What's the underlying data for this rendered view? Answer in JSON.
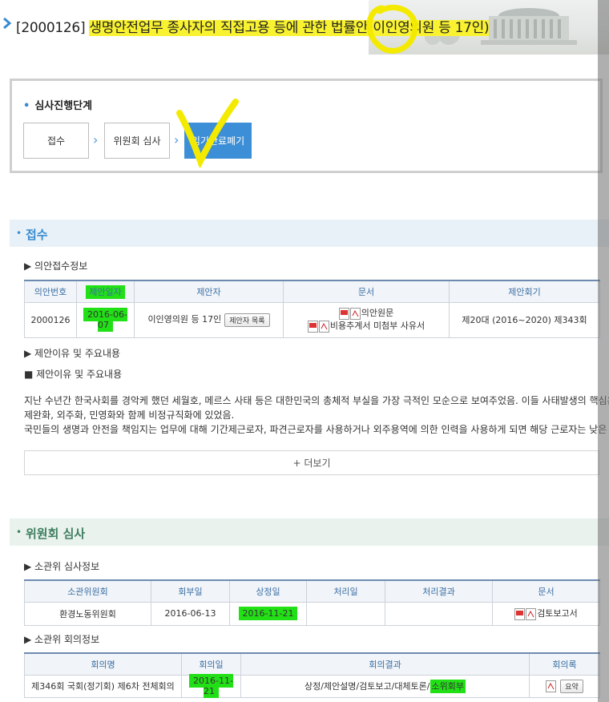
{
  "header": {
    "bill_number": "[2000126]",
    "bill_title": "생명안전업무 종사자의 직접고용 등에 관한 법률안",
    "bill_proposer": "(이인영의원 등 17인)"
  },
  "progress": {
    "label": "심사진행단계",
    "steps": [
      {
        "label": "접수"
      },
      {
        "label": "위원회 심사"
      },
      {
        "label": "임기만료폐기"
      }
    ]
  },
  "receipt": {
    "section_title": "접수",
    "info_title": "▶ 의안접수정보",
    "columns": [
      "의안번호",
      "제안일자",
      "제안자",
      "문서",
      "제안회기"
    ],
    "row": {
      "bill_no": "2000126",
      "date": "2016-06-07",
      "proposer": "이인영의원 등 17인",
      "proposer_btn": "제안자 목록",
      "doc1": "의안원문",
      "doc2": "비용추계서 미첨부 사유서",
      "session": "제20대 (2016~2020) 제343회"
    },
    "reason_title": "▶ 제안이유 및 주요내용",
    "reason_sub": "■ 제안이유 및 주요내용",
    "text_lines": [
      "지난 수년간 한국사회를 경악케 했던 세월호, 메르스 사태 등은 대한민국의 총체적 부실을 가장 극적인 모순으로 보여주었음. 이들 사태발생의 핵심은 규",
      "제완화, 외주화, 민영화와 함께 비정규직화에 있었음.",
      "국민들의 생명과 안전을 책임지는 업무에 대해 기간제근로자, 파견근로자를 사용하거나 외주용역에 의한 인력을 사용하게 되면 해당 근로자는 낮은 소"
    ],
    "more_label": "+ 더보기"
  },
  "committee": {
    "section_title": "위원회 심사",
    "review_title": "▶ 소관위 심사정보",
    "review_columns": [
      "소관위원회",
      "회부일",
      "상정일",
      "처리일",
      "처리결과",
      "문서"
    ],
    "review_row": {
      "committee": "환경노동위원회",
      "referral": "2016-06-13",
      "presented": "2016-11-21",
      "processed": "",
      "result": "",
      "doc": "검토보고서"
    },
    "meeting_title": "▶ 소관위 회의정보",
    "meeting_columns": [
      "회의명",
      "회의일",
      "회의결과",
      "회의록"
    ],
    "meeting_row": {
      "name": "제346회 국회(정기회) 제6차 전체회의",
      "date": "2016-11-21",
      "result_main": "상정/제안설명/검토보고/대체토론/",
      "result_hl": "소위회부",
      "minutes_btn": "요약"
    }
  }
}
